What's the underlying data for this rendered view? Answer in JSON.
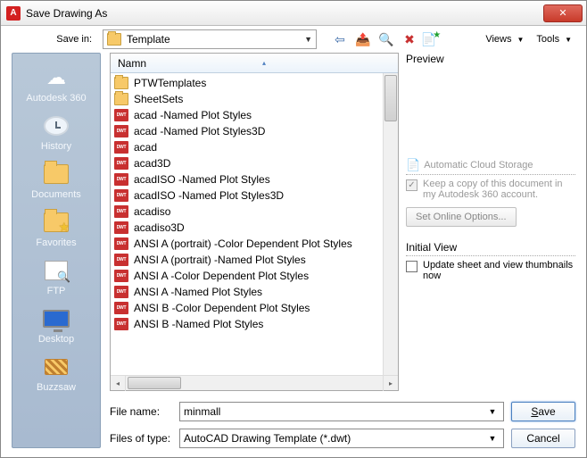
{
  "window": {
    "title": "Save Drawing As",
    "app_badge": "A"
  },
  "toolbar": {
    "save_in_label": "Save in:",
    "save_in_value": "Template",
    "views_label": "Views",
    "tools_label": "Tools"
  },
  "sidebar": {
    "items": [
      {
        "label": "Autodesk 360",
        "icon": "cloud"
      },
      {
        "label": "History",
        "icon": "history"
      },
      {
        "label": "Documents",
        "icon": "folder"
      },
      {
        "label": "Favorites",
        "icon": "favorites"
      },
      {
        "label": "FTP",
        "icon": "ftp"
      },
      {
        "label": "Desktop",
        "icon": "desktop"
      },
      {
        "label": "Buzzsaw",
        "icon": "buzzsaw"
      }
    ]
  },
  "filelist": {
    "header_name": "Namn",
    "items": [
      {
        "type": "folder",
        "name": "PTWTemplates"
      },
      {
        "type": "folder",
        "name": "SheetSets"
      },
      {
        "type": "dwt",
        "name": "acad -Named Plot Styles",
        "sz": "2"
      },
      {
        "type": "dwt",
        "name": "acad -Named Plot Styles3D",
        "sz": "2"
      },
      {
        "type": "dwt",
        "name": "acad",
        "sz": "2"
      },
      {
        "type": "dwt",
        "name": "acad3D",
        "sz": "2"
      },
      {
        "type": "dwt",
        "name": "acadISO -Named Plot Styles",
        "sz": "2"
      },
      {
        "type": "dwt",
        "name": "acadISO -Named Plot Styles3D",
        "sz": "2"
      },
      {
        "type": "dwt",
        "name": "acadiso",
        "sz": "2"
      },
      {
        "type": "dwt",
        "name": "acadiso3D",
        "sz": "2"
      },
      {
        "type": "dwt",
        "name": "ANSI A (portrait) -Color Dependent Plot Styles",
        "sz": "2"
      },
      {
        "type": "dwt",
        "name": "ANSI A (portrait) -Named Plot Styles",
        "sz": "2"
      },
      {
        "type": "dwt",
        "name": "ANSI A -Color Dependent Plot Styles",
        "sz": "2"
      },
      {
        "type": "dwt",
        "name": "ANSI A -Named Plot Styles",
        "sz": "2"
      },
      {
        "type": "dwt",
        "name": "ANSI B -Color Dependent Plot Styles",
        "sz": "2"
      },
      {
        "type": "dwt",
        "name": "ANSI B -Named Plot Styles",
        "sz": "2"
      }
    ]
  },
  "preview": {
    "label": "Preview"
  },
  "cloud": {
    "auto_label": "Automatic Cloud Storage",
    "keep_label": "Keep a copy of this document in my Autodesk 360 account.",
    "keep_checked": true,
    "options_btn": "Set Online Options..."
  },
  "initial_view": {
    "label": "Initial View",
    "update_label": "Update sheet and view thumbnails now",
    "update_checked": false
  },
  "bottom": {
    "filename_label": "File name:",
    "filename_value": "minmall",
    "filetype_label": "Files of type:",
    "filetype_value": "AutoCAD Drawing Template (*.dwt)",
    "save_btn": "Save",
    "cancel_btn": "Cancel"
  }
}
